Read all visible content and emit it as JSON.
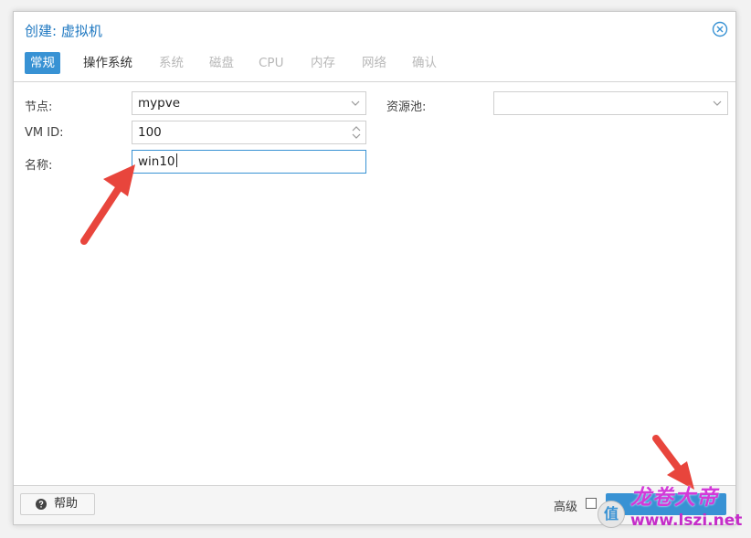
{
  "dialog": {
    "title": "创建: 虚拟机"
  },
  "tabs": [
    {
      "label": "常规",
      "state": "active"
    },
    {
      "label": "操作系统",
      "state": "enabled"
    },
    {
      "label": "系统",
      "state": "disabled"
    },
    {
      "label": "磁盘",
      "state": "disabled"
    },
    {
      "label": "CPU",
      "state": "disabled"
    },
    {
      "label": "内存",
      "state": "disabled"
    },
    {
      "label": "网络",
      "state": "disabled"
    },
    {
      "label": "确认",
      "state": "disabled"
    }
  ],
  "form": {
    "node_label": "节点:",
    "node_value": "mypve",
    "vmid_label": "VM ID:",
    "vmid_value": "100",
    "name_label": "名称:",
    "name_value": "win10",
    "pool_label": "资源池:",
    "pool_value": ""
  },
  "footer": {
    "help_label": "帮助",
    "advanced_label": "高级",
    "advanced_checked": false
  },
  "watermark": {
    "text": "龙卷大帝",
    "url": "www.lszi.net",
    "badge": "值"
  },
  "colors": {
    "accent": "#3892d4",
    "title": "#1f78c1",
    "annotation_arrow": "#e8453c",
    "watermark": "#d33ad8"
  },
  "icons": {
    "close": "close-circle-icon",
    "dropdown": "chevron-down-icon",
    "spinner": "spinner-arrows-icon",
    "help": "question-circle-icon"
  }
}
